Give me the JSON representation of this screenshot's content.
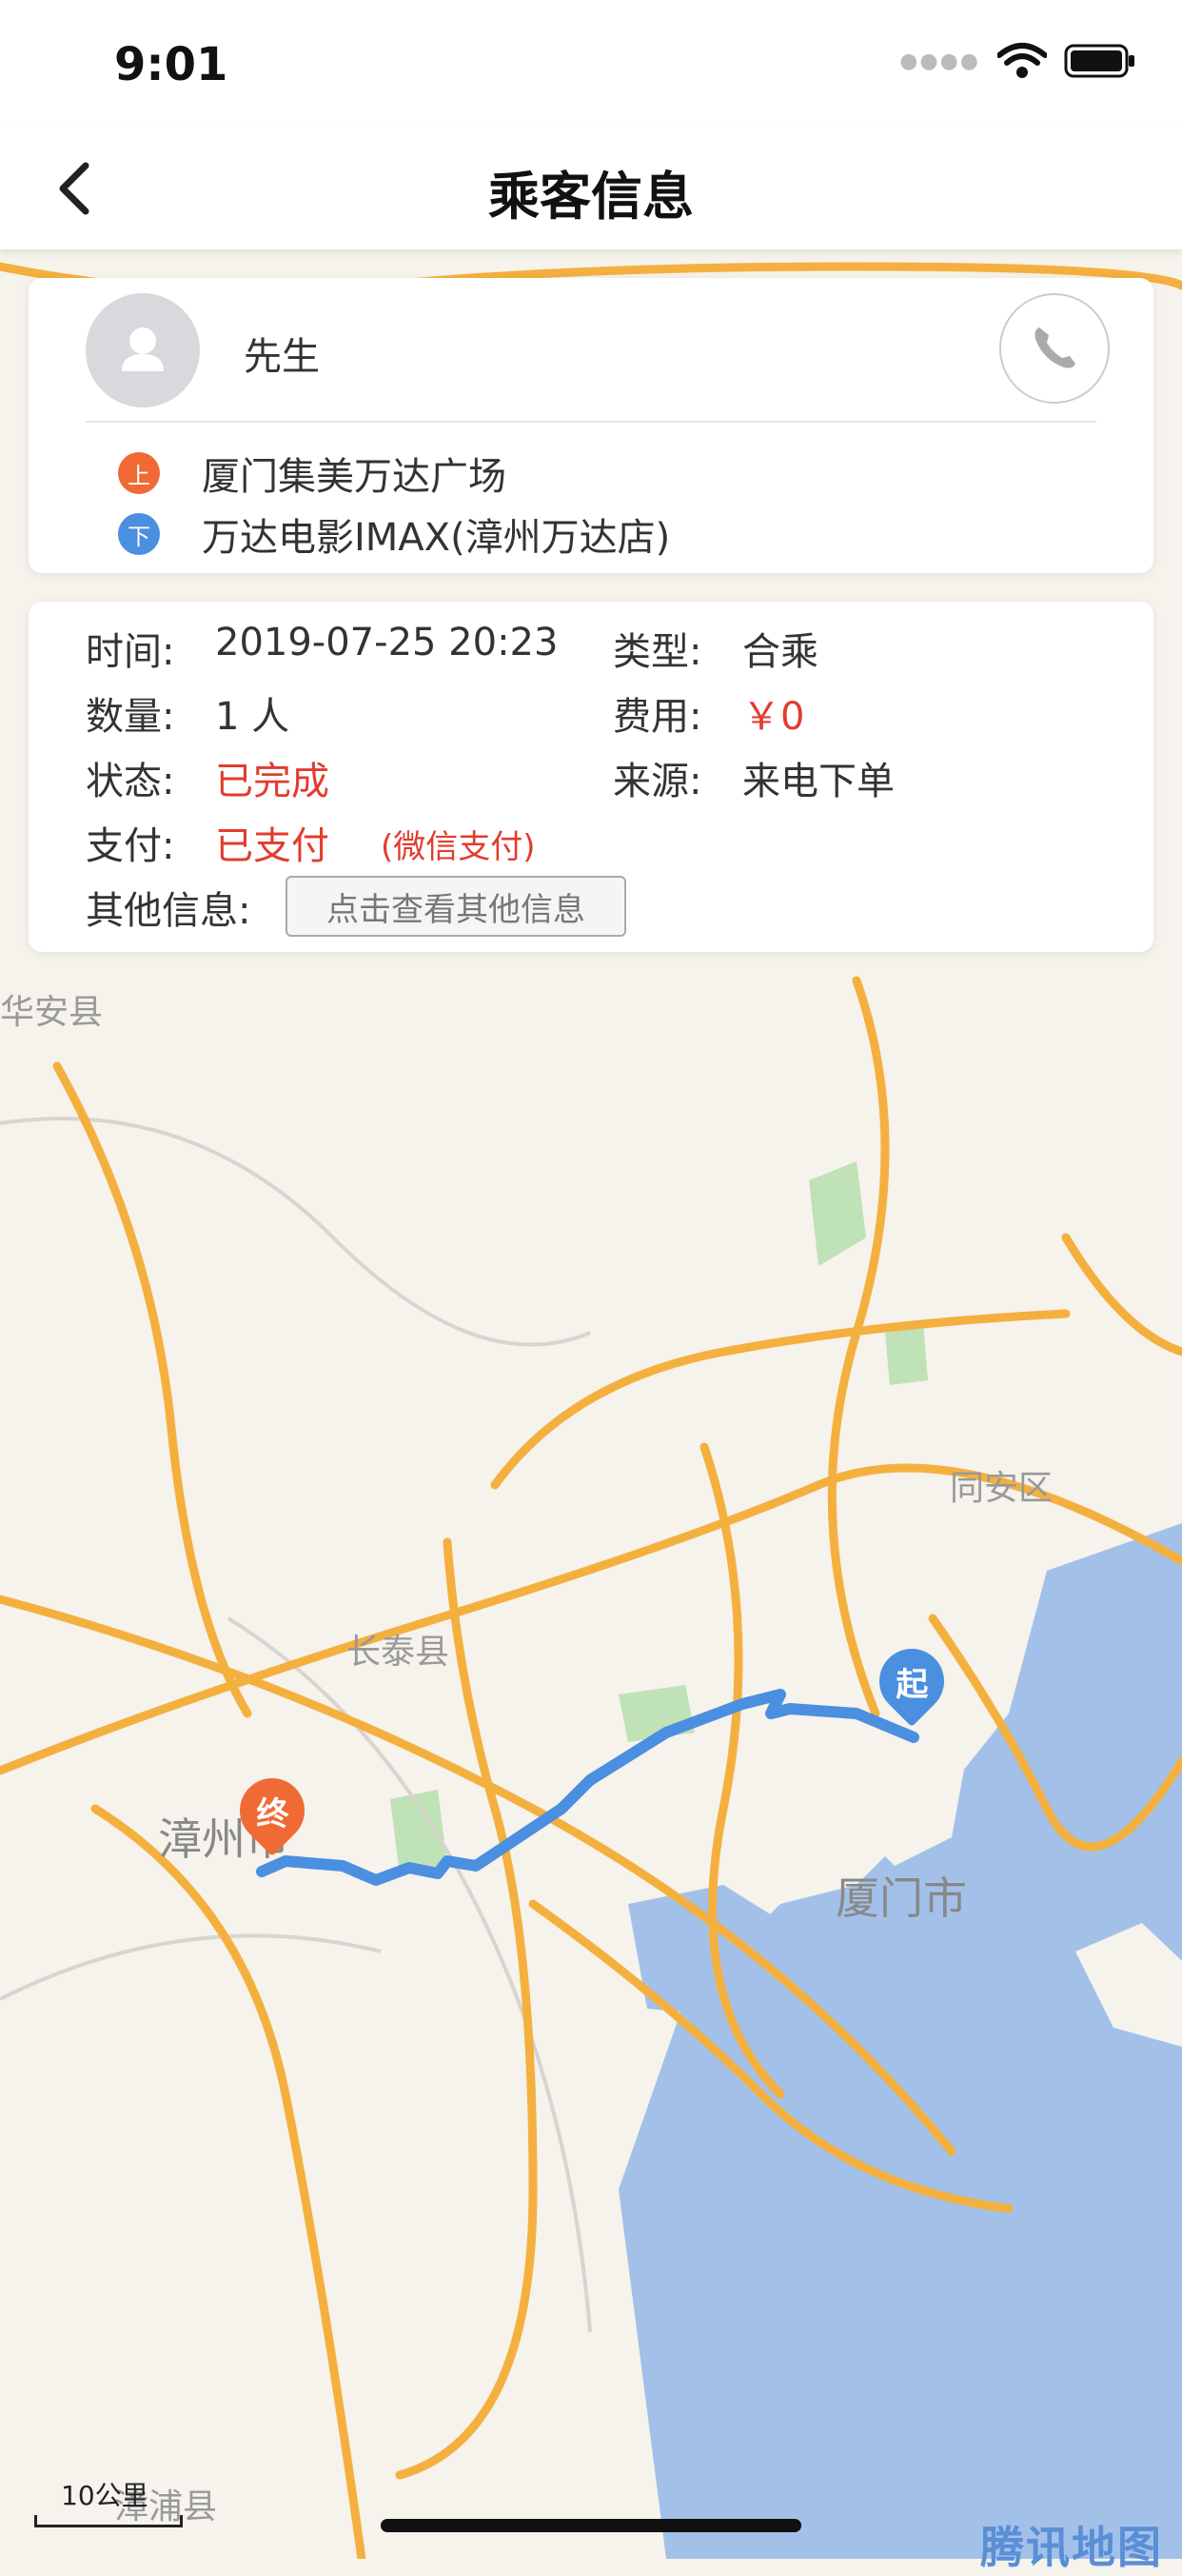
{
  "status_bar": {
    "time": "9:01"
  },
  "nav": {
    "title": "乘客信息"
  },
  "passenger": {
    "name": "先生",
    "pickup_marker": "上",
    "pickup": "厦门集美万达广场",
    "dropoff_marker": "下",
    "dropoff": "万达电影IMAX(漳州万达店)"
  },
  "order": {
    "time_label": "时间:",
    "time_value": "2019-07-25 20:23",
    "type_label": "类型:",
    "type_value": "合乘",
    "count_label": "数量:",
    "count_value": "1 人",
    "fee_label": "费用:",
    "fee_value": "￥0",
    "status_label": "状态:",
    "status_value": "已完成",
    "source_label": "来源:",
    "source_value": "来电下单",
    "pay_label": "支付:",
    "pay_value": "已支付",
    "pay_method": "(微信支付)",
    "other_label": "其他信息:",
    "other_button": "点击查看其他信息"
  },
  "map": {
    "labels": [
      "华安县",
      "同安区",
      "长泰县",
      "漳州市",
      "厦门市",
      "漳浦县"
    ],
    "start_marker": "起",
    "end_marker": "终",
    "scale": "10公里",
    "logo": "腾讯地图"
  },
  "colors": {
    "accent_red": "#e23c2e",
    "route_blue": "#4a8fe0",
    "pickup_orange": "#f06a35",
    "dropoff_blue": "#4a8fe0",
    "road_orange": "#f4b03e",
    "water": "#a3c1e8"
  }
}
